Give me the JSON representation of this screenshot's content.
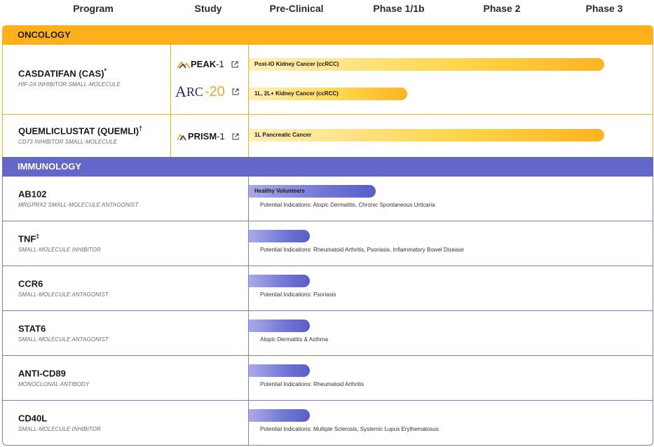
{
  "header": {
    "program": "Program",
    "study": "Study",
    "preclinical": "Pre-Clinical",
    "phase1": "Phase 1/1b",
    "phase2": "Phase 2",
    "phase3": "Phase 3"
  },
  "oncology": {
    "label": "ONCOLOGY",
    "color": "#ffb01a",
    "programs": [
      {
        "name": "CASDATIFAN (CAS)",
        "mark": "*",
        "subtitle": "HIF-2α INHIBITOR SMALL-MOLECULE",
        "studies": [
          {
            "name": "PEAK",
            "num": "-1",
            "icon": "peak-logo-icon",
            "bar_label": "Post-IO Kidney Cancer (ccRCC)",
            "progress": 0.86
          },
          {
            "name_a": "A",
            "name_rc": "RC",
            "num": "-20",
            "icon": "arc-logo-icon",
            "bar_label": "1L, 2L+ Kidney Cancer (ccRCC)",
            "progress": 0.39
          }
        ]
      },
      {
        "name": "QUEMLICLUSTAT (QUEMLI)",
        "mark": "†",
        "subtitle": "CD73 INHIBITOR SMALL-MOLECULE",
        "studies": [
          {
            "name": "PRISM",
            "num": "-1",
            "icon": "prism-logo-icon",
            "bar_label": "1L Pancreatic Cancer",
            "progress": 0.86
          }
        ]
      }
    ]
  },
  "immunology": {
    "label": "IMMUNOLOGY",
    "color": "#6467c9",
    "programs": [
      {
        "name": "AB102",
        "mark": "",
        "subtitle": "MRGPRX2 SMALL-MOLECULE ANTAGONIST",
        "bar_label": "Healthy Volunteers",
        "progress": 0.31,
        "indication": "Potential Indications: Atopic Dermatitis, Chronic Spontaneous Urticaria"
      },
      {
        "name": "TNF",
        "mark": "‡",
        "subtitle": "SMALL-MOLECULE INHIBITOR",
        "bar_label": "",
        "progress": 0.15,
        "indication": "Potential Indications: Rheumatoid Arthritis, Psoriasis, Inflammatory Bowel Disease"
      },
      {
        "name": "CCR6",
        "mark": "",
        "subtitle": "SMALL-MOLECULE ANTAGONIST",
        "bar_label": "",
        "progress": 0.15,
        "indication": "Potential Indications: Psoriasis"
      },
      {
        "name": "STAT6",
        "mark": "",
        "subtitle": "SMALL-MOLECULE ANTAGONIST",
        "bar_label": "",
        "progress": 0.15,
        "indication": "Atopic Dermatitis & Asthma"
      },
      {
        "name": "ANTI-CD89",
        "mark": "",
        "subtitle": "MONOCLONAL ANTIBODY",
        "bar_label": "",
        "progress": 0.15,
        "indication": "Potential Indications: Rheumatoid Arthritis"
      },
      {
        "name": "CD40L",
        "mark": "",
        "subtitle": "SMALL-MOLECULE INHIBITOR",
        "bar_label": "",
        "progress": 0.15,
        "indication": "Potential Indications: Multiple Sclerosis, Systemic Lupus Erythematosus"
      }
    ]
  }
}
